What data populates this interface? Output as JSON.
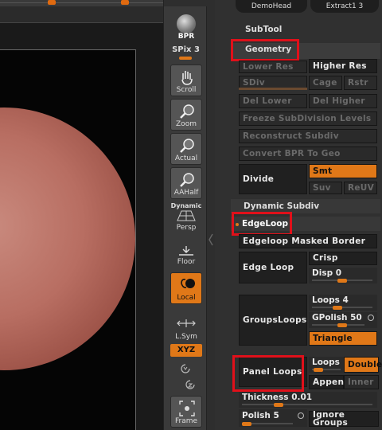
{
  "viewport": {},
  "shelf": {
    "bpr": "BPR",
    "spix_label": "SPix 3",
    "scroll": "Scroll",
    "zoom": "Zoom",
    "actual": "Actual",
    "aahalf": "AAHalf",
    "dynamic": "Dynamic",
    "persp": "Persp",
    "floor": "Floor",
    "local": "Local",
    "lsym": "L.Sym",
    "xyz": "XYZ",
    "frame": "Frame"
  },
  "top": {
    "demohead": "DemoHead",
    "extract": "Extract1 3"
  },
  "subtool": {
    "title": "SubTool",
    "geometry": "Geometry",
    "lower_res": "Lower Res",
    "higher_res": "Higher Res",
    "sdiv": "SDiv",
    "cage": "Cage",
    "rstr": "Rstr",
    "del_lower": "Del Lower",
    "del_higher": "Del Higher",
    "freeze": "Freeze SubDivision Levels",
    "reconstruct": "Reconstruct Subdiv",
    "convert_bpr": "Convert BPR To Geo",
    "divide": "Divide",
    "smt": "Smt",
    "suv": "Suv",
    "reuv": "ReUV",
    "dynamic_subdiv": "Dynamic Subdiv",
    "edgeloop": "EdgeLoop",
    "edgeloop_masked": "Edgeloop Masked Border",
    "edge_loop": "Edge Loop",
    "crisp": "Crisp",
    "disp": "Disp 0",
    "disp_value": 0,
    "groupsloops": "GroupsLoops",
    "loops": "Loops 4",
    "loops_value": 4,
    "gpolish": "GPolish 50",
    "gpolish_value": 50,
    "triangle": "Triangle",
    "panel_loops": "Panel Loops",
    "pl_loops": "Loops",
    "double": "Double",
    "append": "Append",
    "inner": "Inner",
    "thickness": "Thickness 0.01",
    "polish": "Polish 5",
    "ignore_groups": "Ignore Groups"
  },
  "colors": {
    "accent": "#e07818",
    "highlight": "#e0101a"
  }
}
